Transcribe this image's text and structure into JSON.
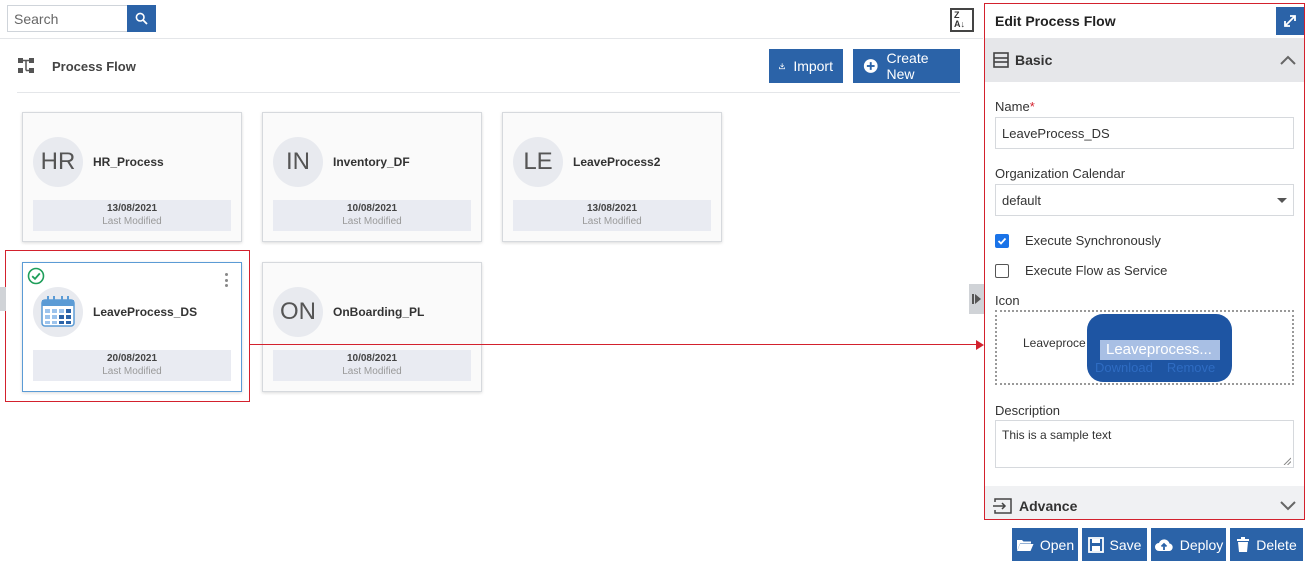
{
  "search": {
    "placeholder": "Search"
  },
  "header": {
    "title": "Process Flow",
    "import_label": "Import",
    "create_label": "Create New"
  },
  "cards": [
    {
      "initials": "HR",
      "name": "HR_Process",
      "date": "13/08/2021",
      "modified_label": "Last Modified"
    },
    {
      "initials": "IN",
      "name": "Inventory_DF",
      "date": "10/08/2021",
      "modified_label": "Last Modified"
    },
    {
      "initials": "LE",
      "name": "LeaveProcess2",
      "date": "13/08/2021",
      "modified_label": "Last Modified"
    },
    {
      "initials": "",
      "name": "LeaveProcess_DS",
      "date": "20/08/2021",
      "modified_label": "Last Modified",
      "selected": true
    },
    {
      "initials": "ON",
      "name": "OnBoarding_PL",
      "date": "10/08/2021",
      "modified_label": "Last Modified"
    }
  ],
  "panel": {
    "title": "Edit Process Flow",
    "basic_label": "Basic",
    "name_label": "Name",
    "name_required": "*",
    "name_value": "LeaveProcess_DS",
    "calendar_label": "Organization Calendar",
    "calendar_value": "default",
    "exec_sync_label": "Execute Synchronously",
    "exec_sync_checked": true,
    "exec_service_label": "Execute Flow as Service",
    "exec_service_checked": false,
    "icon_label": "Icon",
    "icon_file_text": "Leaveproce",
    "icon_popup_name": "Leaveprocess...",
    "download_label": "Download",
    "remove_label": "Remove",
    "description_label": "Description",
    "description_value": "This is a sample text",
    "advance_label": "Advance"
  },
  "actions": {
    "open": "Open",
    "save": "Save",
    "deploy": "Deploy",
    "delete": "Delete"
  },
  "colors": {
    "primary": "#2b63a8",
    "highlight": "#d3212d",
    "success": "#1e9e5a"
  }
}
